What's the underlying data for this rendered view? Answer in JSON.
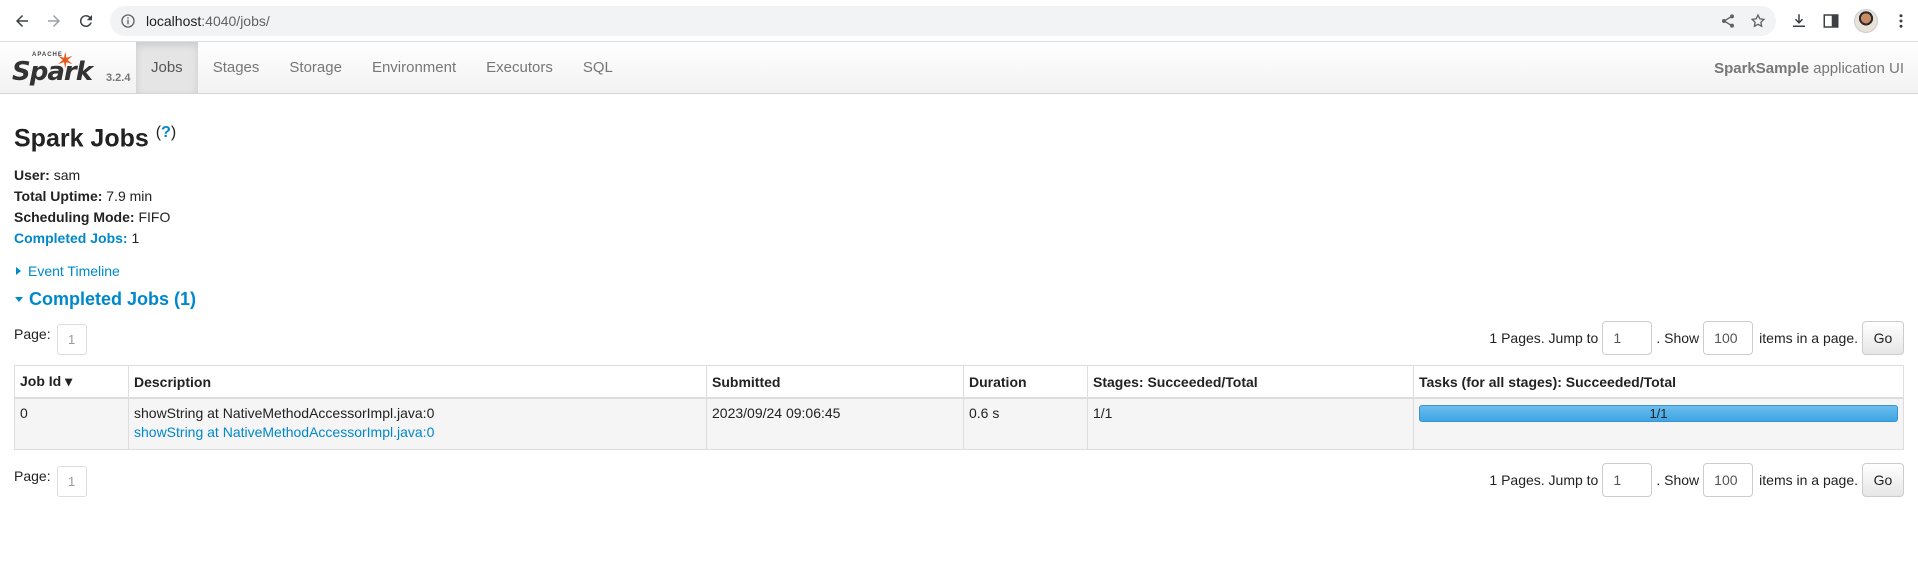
{
  "browser": {
    "url_host": "localhost",
    "url_path": ":4040/jobs/"
  },
  "navbar": {
    "brand_small": "APACHE",
    "brand_word": "Spark",
    "version": "3.2.4",
    "tabs": [
      {
        "label": "Jobs",
        "active": true
      },
      {
        "label": "Stages"
      },
      {
        "label": "Storage"
      },
      {
        "label": "Environment"
      },
      {
        "label": "Executors"
      },
      {
        "label": "SQL"
      }
    ],
    "app_name": "SparkSample",
    "app_suffix": "application UI"
  },
  "page": {
    "title": "Spark Jobs",
    "help": "?",
    "summary": {
      "user_label": "User:",
      "user_value": "sam",
      "uptime_label": "Total Uptime:",
      "uptime_value": "7.9 min",
      "mode_label": "Scheduling Mode:",
      "mode_value": "FIFO",
      "completed_label": "Completed Jobs:",
      "completed_value": "1"
    },
    "event_timeline": "Event Timeline",
    "completed_section": "Completed Jobs (1)"
  },
  "pager": {
    "page_label": "Page:",
    "current_page": "1",
    "pages_text": "1 Pages. Jump to",
    "jump_value": "1",
    "show_text": ". Show",
    "show_value": "100",
    "items_text": "items in a page.",
    "go_label": "Go"
  },
  "table": {
    "headers": [
      "Job Id ▾",
      "Description",
      "Submitted",
      "Duration",
      "Stages: Succeeded/Total",
      "Tasks (for all stages): Succeeded/Total"
    ],
    "rows": [
      {
        "job_id": "0",
        "description": "showString at NativeMethodAccessorImpl.java:0",
        "description_link": "showString at NativeMethodAccessorImpl.java:0",
        "submitted": "2023/09/24 09:06:45",
        "duration": "0.6 s",
        "stages": "1/1",
        "tasks": "1/1",
        "tasks_progress": 1.0
      }
    ]
  }
}
